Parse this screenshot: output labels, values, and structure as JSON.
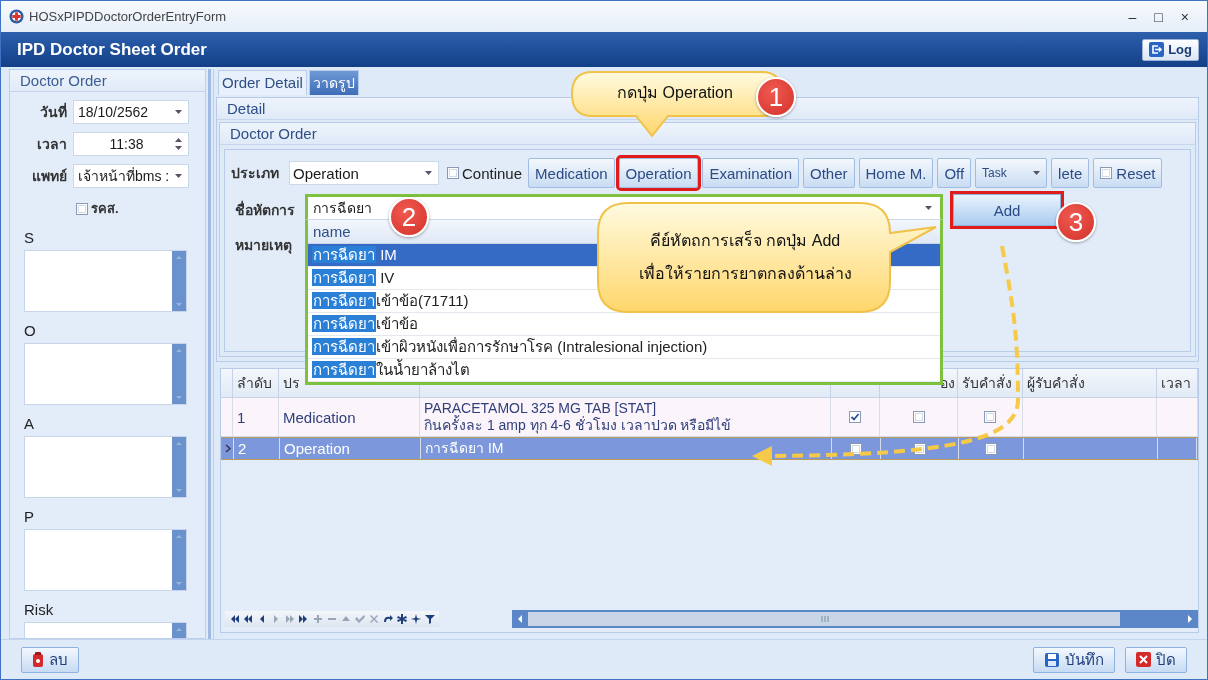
{
  "window": {
    "title": "HOSxPIPDDoctorOrderEntryForm",
    "controls": [
      "–",
      "□",
      "×"
    ]
  },
  "header": {
    "title": "IPD Doctor Sheet Order",
    "log_button": "Log"
  },
  "left_panel": {
    "title": "Doctor Order",
    "fields": [
      {
        "label": "วันที่",
        "value": "18/10/2562",
        "kind": "combo"
      },
      {
        "label": "เวลา",
        "value": "11:38",
        "kind": "spin"
      },
      {
        "label": "แพทย์",
        "value": "เจ้าหน้าที่bms :",
        "kind": "combo"
      }
    ],
    "rks": {
      "label": "รคส.",
      "checked": false
    },
    "memos": [
      {
        "label": "S"
      },
      {
        "label": "O"
      },
      {
        "label": "A"
      },
      {
        "label": "P"
      },
      {
        "label": "Risk"
      }
    ]
  },
  "tabs": [
    {
      "label": "Order Detail",
      "selected": true
    },
    {
      "label": "วาดรูป",
      "selected": false
    }
  ],
  "detail_header": "Detail",
  "order_header": "Doctor Order",
  "type_field": {
    "label": "ประเภท",
    "value": "Operation"
  },
  "continue": {
    "label": "Continue",
    "checked": false
  },
  "order_buttons": [
    {
      "label": "Medication",
      "kind": "button",
      "highlighted": false
    },
    {
      "label": "Operation",
      "kind": "button",
      "highlighted": true
    },
    {
      "label": "Examination",
      "kind": "button",
      "highlighted": false
    },
    {
      "label": "Other",
      "kind": "button",
      "highlighted": false
    },
    {
      "label": "Home M.",
      "kind": "button",
      "highlighted": false
    },
    {
      "label": "Off",
      "kind": "button",
      "highlighted": false
    },
    {
      "label": "Task",
      "kind": "dropdown",
      "highlighted": false
    },
    {
      "label": "lete",
      "kind": "button",
      "highlighted": false
    },
    {
      "label": "Reset",
      "kind": "check",
      "highlighted": false
    }
  ],
  "procedure_field": {
    "label": "ชื่อหัตการ",
    "value": "การฉีดยา",
    "highlighted": true
  },
  "add_button": {
    "label": "Add",
    "highlighted": true
  },
  "note_label": "หมายเหตุ",
  "dropdown": {
    "header": "name",
    "items": [
      {
        "match": "การฉีดยา",
        "rest": " IM",
        "selected": true
      },
      {
        "match": "การฉีดยา",
        "rest": " IV",
        "selected": false
      },
      {
        "match": "การฉีดยา",
        "rest": "เข้าข้อ(71711)",
        "selected": false
      },
      {
        "match": "การฉีดยา",
        "rest": "เข้าข้อ",
        "selected": false
      },
      {
        "match": "การฉีดยา",
        "rest": "เข้าผิวหนังเพื่อการรักษาโรค (Intralesional injection)",
        "selected": false
      },
      {
        "match": "การฉีดยา",
        "rest": "ในน้ำยาล้างไต",
        "selected": false
      }
    ]
  },
  "table": {
    "columns": [
      {
        "label": "ลำดับ"
      },
      {
        "label": "ปร"
      },
      {
        "label": "อง"
      },
      {
        "label": "รับคำสั่ง"
      },
      {
        "label": "ผู้รับคำสั่ง"
      },
      {
        "label": "เวลา"
      }
    ],
    "rows": [
      {
        "no": "1",
        "type": "Medication",
        "detail": [
          "PARACETAMOL 325 MG TAB [STAT]",
          "กินครั้งละ 1 amp ทุก 4-6 ชั่วโมง เวลาปวด หรือมีไข้"
        ],
        "checks": [
          true,
          false,
          false
        ],
        "selected": false
      },
      {
        "no": "2",
        "type": "Operation",
        "detail": [
          "การฉีดยา IM"
        ],
        "checks": [
          false,
          false,
          false
        ],
        "selected": true
      }
    ]
  },
  "footer": {
    "delete_button": "ลบ",
    "save_button": "บันทึก",
    "close_button": "ปิด"
  },
  "annotations": [
    {
      "number": "1",
      "lines": [
        "กดปุ่ม Operation"
      ]
    },
    {
      "number": "2"
    },
    {
      "number": "3",
      "lines": [
        "คีย์หัตถการเสร็จ กดปุ่ม Add",
        "เพื่อให้รายการยาตกลงด้านล่าง"
      ]
    }
  ]
}
